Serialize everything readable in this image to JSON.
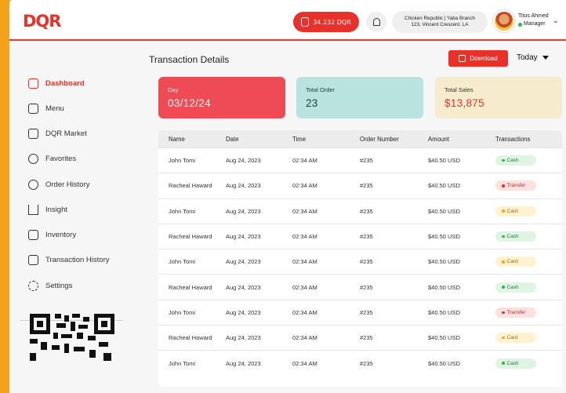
{
  "header": {
    "logo_text": "DQR",
    "wallet_balance": "34.232 DQR",
    "branch_line1": "Chicken Republic | Yaba Branch",
    "branch_line2": "123, Vincent Crescent. LA",
    "user_name": "Titus Ahmed",
    "user_role": "Manager"
  },
  "sidebar": {
    "items": [
      {
        "label": "Dashboard",
        "icon": "dashboard-icon",
        "active": true
      },
      {
        "label": "Menu",
        "icon": "menu-icon"
      },
      {
        "label": "DQR Market",
        "icon": "market-icon"
      },
      {
        "label": "Favorites",
        "icon": "heart-icon"
      },
      {
        "label": "Order History",
        "icon": "history-icon"
      },
      {
        "label": "Insight",
        "icon": "chart-icon"
      },
      {
        "label": "Inventory",
        "icon": "inventory-icon"
      },
      {
        "label": "Transaction History",
        "icon": "transaction-icon"
      },
      {
        "label": "Settings",
        "icon": "gear-icon"
      }
    ]
  },
  "main": {
    "title": "Transaction Details",
    "download_label": "Download",
    "period_label": "Today",
    "cards": {
      "day_label": "Day",
      "day_value": "03/12/24",
      "order_label": "Total Order",
      "order_value": "23",
      "sales_label": "Total Sales",
      "sales_value": "$13,875"
    },
    "table": {
      "headers": [
        "Name",
        "Date",
        "Time",
        "Order Number",
        "Amount",
        "Transactions"
      ],
      "rows": [
        [
          "John Tomi",
          "Aug 24, 2023",
          "02:34 AM",
          "#235",
          "$40.50 USD",
          "Cash"
        ],
        [
          "Racheal Haward",
          "Aug 24, 2023",
          "02:34 AM",
          "#235",
          "$40.50 USD",
          "Transfer"
        ],
        [
          "John Tomi",
          "Aug 24, 2023",
          "02:34 AM",
          "#235",
          "$40.50 USD",
          "Card"
        ],
        [
          "Racheal Haward",
          "Aug 24, 2023",
          "02:34 AM",
          "#235",
          "$40.50 USD",
          "Cash"
        ],
        [
          "John Tomi",
          "Aug 24, 2023",
          "02:34 AM",
          "#235",
          "$40.50 USD",
          "Card"
        ],
        [
          "Racheal Haward",
          "Aug 24, 2023",
          "02:34 AM",
          "#235",
          "$40.50 USD",
          "Cash"
        ],
        [
          "John Tomi",
          "Aug 24, 2023",
          "02:34 AM",
          "#235",
          "$40.50 USD",
          "Transfer"
        ],
        [
          "Racheal Haward",
          "Aug 24, 2023",
          "02:34 AM",
          "#235",
          "$40.50 USD",
          "Card"
        ],
        [
          "John Tomi",
          "Aug 24, 2023",
          "02:34 AM",
          "#235",
          "$40.50 USD",
          "Cash"
        ]
      ]
    }
  },
  "colors": {
    "brand_red": "#e8312a",
    "background_orange": "#f3a21a",
    "cash_green": "#2fb84d",
    "card_yellow": "#f2a516"
  }
}
